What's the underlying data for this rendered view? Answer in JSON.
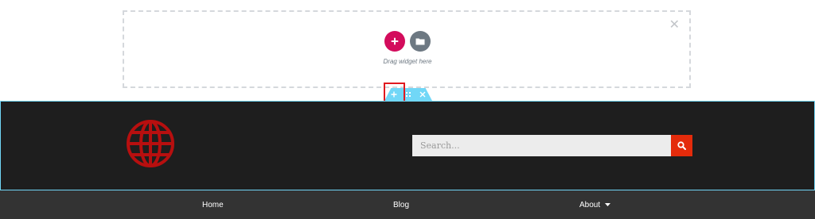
{
  "dropzone": {
    "hint": "Drag widget here",
    "icons": {
      "add": "plus-icon",
      "template": "folder-icon",
      "close": "close-icon"
    },
    "close_glyph": "✕"
  },
  "section_handle": {
    "icons": [
      "plus-icon",
      "move-handle-icon",
      "close-icon"
    ]
  },
  "header": {
    "logo_icon": "globe-icon",
    "search": {
      "placeholder": "Search...",
      "value": "",
      "button_icon": "search-icon"
    }
  },
  "nav": {
    "items": [
      {
        "label": "Home"
      },
      {
        "label": "Blog"
      },
      {
        "label": "About",
        "has_dropdown": true,
        "dropdown_icon": "caret-down-icon"
      }
    ]
  },
  "colors": {
    "add_button": "#d30c5c",
    "folder_button": "#6d7882",
    "handle": "#71d7f7",
    "highlight": "#e0191f",
    "section_bg": "#1e1e1e",
    "logo": "#b70f0f",
    "search_button": "#e42b0b",
    "nav_bg": "#333333"
  }
}
